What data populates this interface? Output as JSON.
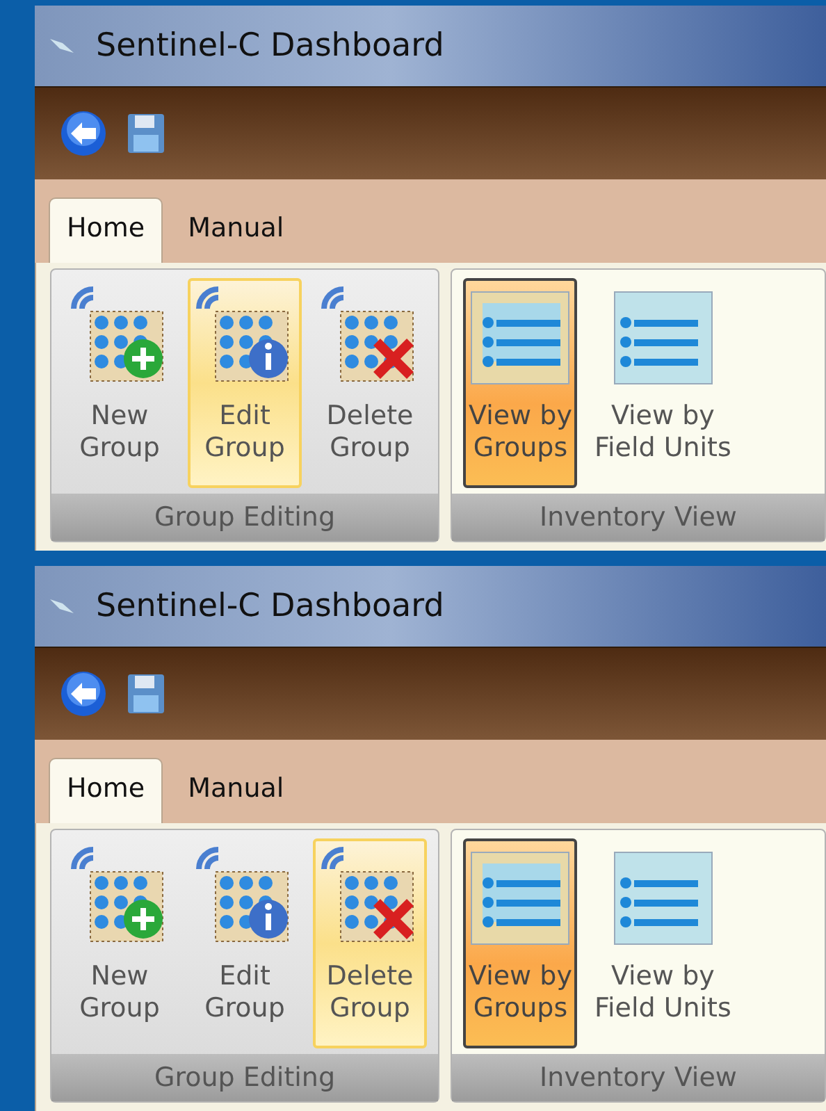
{
  "panels": [
    {
      "window": {
        "title": "Sentinel-C Dashboard"
      },
      "tabs": [
        {
          "label": "Home",
          "selected": true
        },
        {
          "label": "Manual",
          "selected": false
        }
      ],
      "groups": [
        {
          "label": "Group Editing",
          "buttons": [
            {
              "kind": "new",
              "label": "New\nGroup",
              "highlighted": false,
              "selected": false
            },
            {
              "kind": "edit",
              "label": "Edit\nGroup",
              "highlighted": true,
              "selected": false
            },
            {
              "kind": "delete",
              "label": "Delete\nGroup",
              "highlighted": false,
              "selected": false
            }
          ]
        },
        {
          "label": "Inventory View",
          "buttons": [
            {
              "kind": "groups",
              "label": "View by\nGroups",
              "highlighted": false,
              "selected": true
            },
            {
              "kind": "units",
              "label": "View by\nField Units",
              "highlighted": false,
              "selected": false
            }
          ]
        }
      ]
    },
    {
      "window": {
        "title": "Sentinel-C Dashboard"
      },
      "tabs": [
        {
          "label": "Home",
          "selected": true
        },
        {
          "label": "Manual",
          "selected": false
        }
      ],
      "groups": [
        {
          "label": "Group Editing",
          "buttons": [
            {
              "kind": "new",
              "label": "New\nGroup",
              "highlighted": false,
              "selected": false
            },
            {
              "kind": "edit",
              "label": "Edit\nGroup",
              "highlighted": false,
              "selected": false
            },
            {
              "kind": "delete",
              "label": "Delete\nGroup",
              "highlighted": true,
              "selected": false
            }
          ]
        },
        {
          "label": "Inventory View",
          "buttons": [
            {
              "kind": "groups",
              "label": "View by\nGroups",
              "highlighted": false,
              "selected": true
            },
            {
              "kind": "units",
              "label": "View by\nField Units",
              "highlighted": false,
              "selected": false
            }
          ]
        }
      ]
    }
  ]
}
